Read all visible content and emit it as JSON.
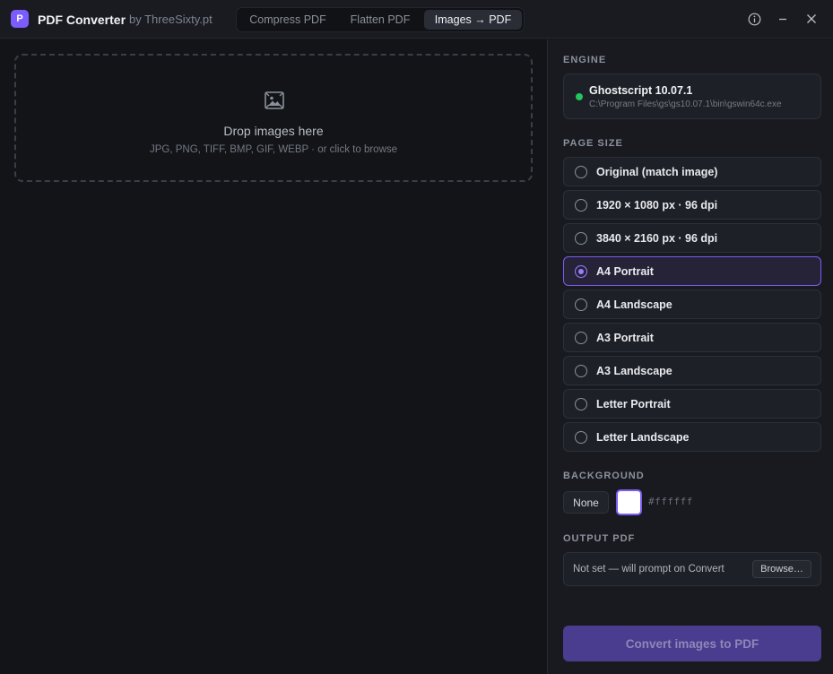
{
  "app": {
    "logo_letter": "P",
    "title": "PDF Converter",
    "subtitle": "by ThreeSixty.pt",
    "accent": "#7b5cff"
  },
  "tabs": [
    {
      "label": "Compress PDF",
      "active": false
    },
    {
      "label": "Flatten PDF",
      "active": false
    },
    {
      "label": "Images → PDF",
      "active": true
    }
  ],
  "window_controls": {
    "info_icon": "info-icon",
    "minimize_glyph": "–",
    "close_glyph": "✕"
  },
  "dropzone": {
    "icon": "image-icon",
    "title": "Drop images here",
    "subtitle": "JPG, PNG, TIFF, BMP, GIF, WEBP · or click to browse"
  },
  "engine": {
    "section_label": "ENGINE",
    "name": "Ghostscript 10.07.1",
    "path": "C:\\Program Files\\gs\\gs10.07.1\\bin\\gswin64c.exe",
    "status_color": "#22c55e"
  },
  "page_size": {
    "section_label": "PAGE SIZE",
    "options": [
      {
        "label": "Original (match image)",
        "selected": false
      },
      {
        "label": "1920 × 1080 px · 96 dpi",
        "selected": false
      },
      {
        "label": "3840 × 2160 px · 96 dpi",
        "selected": false
      },
      {
        "label": "A4 Portrait",
        "selected": true
      },
      {
        "label": "A4 Landscape",
        "selected": false
      },
      {
        "label": "A3 Portrait",
        "selected": false
      },
      {
        "label": "A3 Landscape",
        "selected": false
      },
      {
        "label": "Letter Portrait",
        "selected": false
      },
      {
        "label": "Letter Landscape",
        "selected": false
      }
    ]
  },
  "background": {
    "section_label": "BACKGROUND",
    "none_label": "None",
    "color": "#ffffff",
    "hex_text": "#ffffff"
  },
  "output": {
    "section_label": "OUTPUT PDF",
    "value_text": "Not set — will prompt on Convert",
    "browse_label": "Browse…"
  },
  "convert_button": {
    "label": "Convert images to PDF"
  }
}
